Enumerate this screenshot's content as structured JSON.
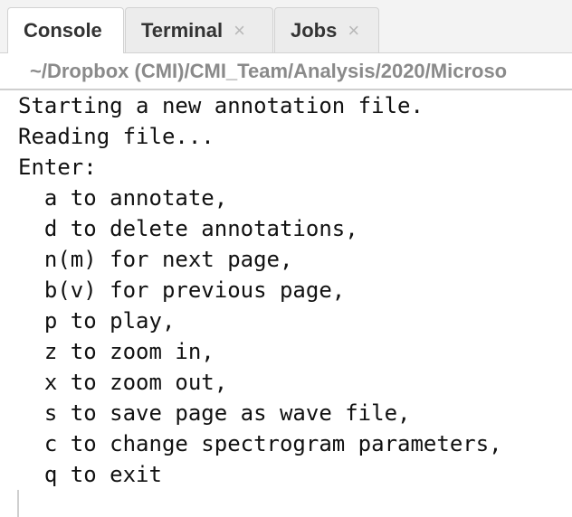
{
  "tabs": [
    {
      "label": "Console",
      "closable": false,
      "active": true
    },
    {
      "label": "Terminal",
      "closable": true,
      "active": false
    },
    {
      "label": "Jobs",
      "closable": true,
      "active": false
    }
  ],
  "close_glyph": "×",
  "working_directory": "~/Dropbox (CMI)/CMI_Team/Analysis/2020/Microso",
  "console_lines": [
    "Starting a new annotation file.",
    "Reading file...",
    "Enter:",
    "  a to annotate,",
    "  d to delete annotations,",
    "  n(m) for next page,",
    "  b(v) for previous page,",
    "  p to play,",
    "  z to zoom in,",
    "  x to zoom out,",
    "  s to save page as wave file,",
    "  c to change spectrogram parameters,",
    "  q to exit"
  ],
  "colors": {
    "tab_bg": "#ececec",
    "active_tab_bg": "#ffffff",
    "path_text": "#8a8a8a",
    "console_text": "#111111"
  }
}
